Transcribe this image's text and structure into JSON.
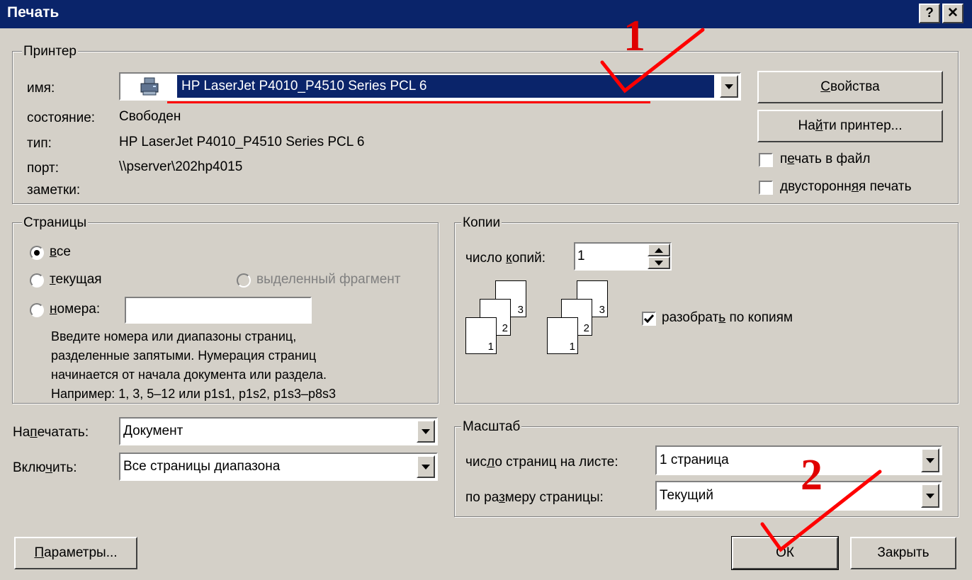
{
  "window": {
    "title": "Печать",
    "help_button": "?",
    "close_button": "✕"
  },
  "printer": {
    "group_label": "Принтер",
    "name_label": "имя:",
    "name_value": "HP LaserJet P4010_P4510 Series PCL 6",
    "status_label": "состояние:",
    "status_value": "Свободен",
    "type_label": "тип:",
    "type_value": "HP LaserJet P4010_P4510 Series PCL 6",
    "port_label": "порт:",
    "port_value": "\\\\pserver\\202hp4015",
    "notes_label": "заметки:",
    "properties_button": {
      "pre": "",
      "key": "С",
      "post": "войства"
    },
    "find_printer_button": {
      "pre": "На",
      "key": "й",
      "post": "ти принтер..."
    },
    "print_to_file": {
      "pre": "п",
      "key": "е",
      "post": "чать в файл",
      "checked": false
    },
    "duplex": {
      "pre": "двусторонн",
      "key": "я",
      "post": "я печать",
      "checked": false
    }
  },
  "pages": {
    "group_label": "Страницы",
    "all": {
      "pre": "",
      "key": "в",
      "post": "се",
      "selected": true
    },
    "current": {
      "pre": "",
      "key": "т",
      "post": "екущая"
    },
    "selection": "выделенный фрагмент",
    "numbers": {
      "pre": "",
      "key": "н",
      "post": "омера:"
    },
    "numbers_value": "",
    "hint_lines": [
      "Введите номера или диапазоны страниц,",
      "разделенные запятыми. Нумерация страниц",
      "начинается от начала документа или раздела.",
      "Например: 1, 3, 5–12 или p1s1, p1s2, p1s3–p8s3"
    ]
  },
  "copies": {
    "group_label": "Копии",
    "count_label": {
      "pre": "число ",
      "key": "к",
      "post": "опий:"
    },
    "count_value": "1",
    "page_numbers": [
      "1",
      "2",
      "3"
    ],
    "collate": {
      "pre": "разобрат",
      "key": "ь",
      "post": " по копиям",
      "checked": true
    }
  },
  "print_what": {
    "label": {
      "pre": "На",
      "key": "п",
      "post": "ечатать:"
    },
    "value": "Документ"
  },
  "include": {
    "label": {
      "pre": "Вклю",
      "key": "ч",
      "post": "ить:"
    },
    "value": "Все страницы диапазона"
  },
  "zoom": {
    "group_label": "Масштаб",
    "pages_per_sheet_label": {
      "pre": "чис",
      "key": "л",
      "post": "о страниц на листе:"
    },
    "pages_per_sheet_value": "1 страница",
    "scale_label": {
      "pre": "по ра",
      "key": "з",
      "post": "меру страницы:"
    },
    "scale_value": "Текущий"
  },
  "buttons": {
    "options": {
      "pre": "",
      "key": "П",
      "post": "араметры..."
    },
    "ok": "ОК",
    "close": "Закрыть"
  },
  "annotations": {
    "mark_1": "1",
    "mark_2": "2",
    "color": "#ff0000"
  },
  "colors": {
    "titlebar": "#0a246a",
    "dialog": "#d4d0c8",
    "selection": "#0a246a"
  }
}
